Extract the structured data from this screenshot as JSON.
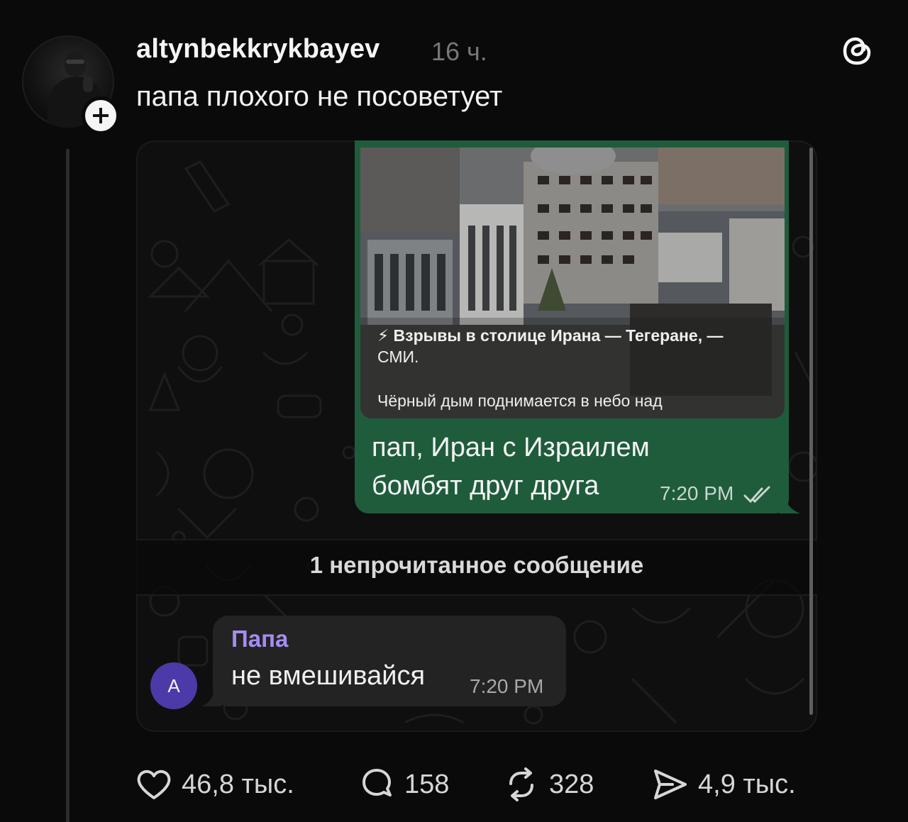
{
  "post": {
    "username": "altynbekkrykbayev",
    "time": "16 ч.",
    "caption": "папа плохого не посоветует",
    "follow_icon": "plus-icon",
    "logo_icon": "threads-logo-icon"
  },
  "chat": {
    "outgoing": {
      "news_title_line1": "⚡ Взрывы в столице Ирана — Тегеране, —",
      "news_title_line2": "СМИ.",
      "news_sub": "Чёрный дым поднимается в небо над",
      "text_line1": "пап, Иран с Израилем",
      "text_line2": "бомбят друг друга",
      "time": "7:20 PM",
      "status_icon": "double-check-icon",
      "bubble_color": "#1f5c3c"
    },
    "unread_label": "1 непрочитанное сообщение",
    "incoming": {
      "sender": "Папа",
      "text": "не вмешивайся",
      "time": "7:20 PM",
      "avatar_letter": "A",
      "sender_color": "#a58cf2",
      "avatar_color": "#4b3aa8"
    }
  },
  "actions": [
    {
      "icon": "heart-icon",
      "count": "46,8 тыс."
    },
    {
      "icon": "comment-icon",
      "count": "158"
    },
    {
      "icon": "repost-icon",
      "count": "328"
    },
    {
      "icon": "share-icon",
      "count": "4,9 тыс."
    }
  ]
}
